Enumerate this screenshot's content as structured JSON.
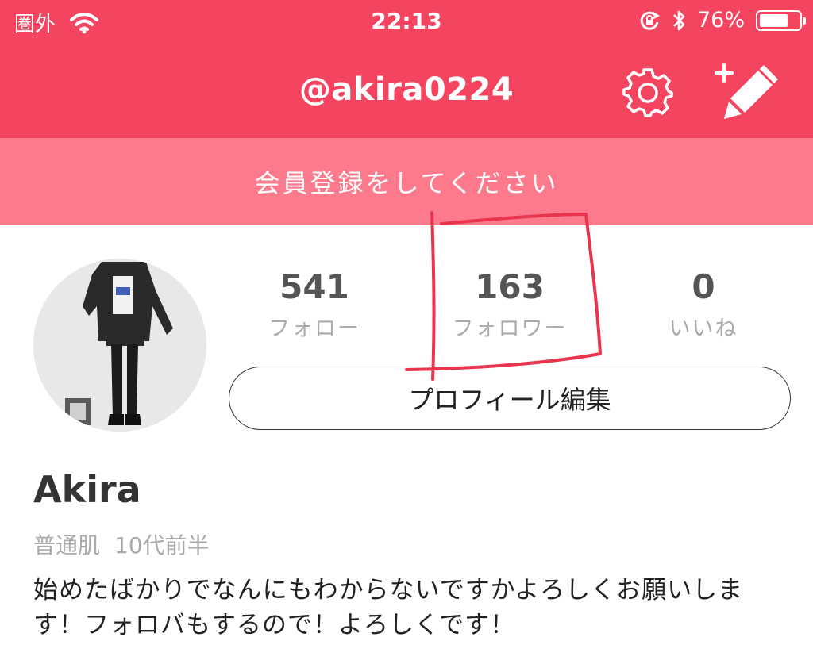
{
  "status_bar": {
    "carrier": "圏外",
    "time": "22:13",
    "battery_text": "76%",
    "battery_level": 0.76
  },
  "navbar": {
    "username": "@akira0224"
  },
  "banner": {
    "text": "会員登録をしてください"
  },
  "profile": {
    "stats": [
      {
        "count": "541",
        "label": "フォロー"
      },
      {
        "count": "163",
        "label": "フォロワー"
      },
      {
        "count": "0",
        "label": "いいね"
      }
    ],
    "edit_button_label": "プロフィール編集",
    "display_name": "Akira",
    "skin_type": "普通肌",
    "age_group": "10代前半",
    "bio": "始めたばかりでなんにもわからないですかよろしくお願いしま す！フォロバもするので！よろしくです！"
  },
  "colors": {
    "header": "#f4445f",
    "banner": "#fd7a8c",
    "annotation": "#e8344c"
  }
}
